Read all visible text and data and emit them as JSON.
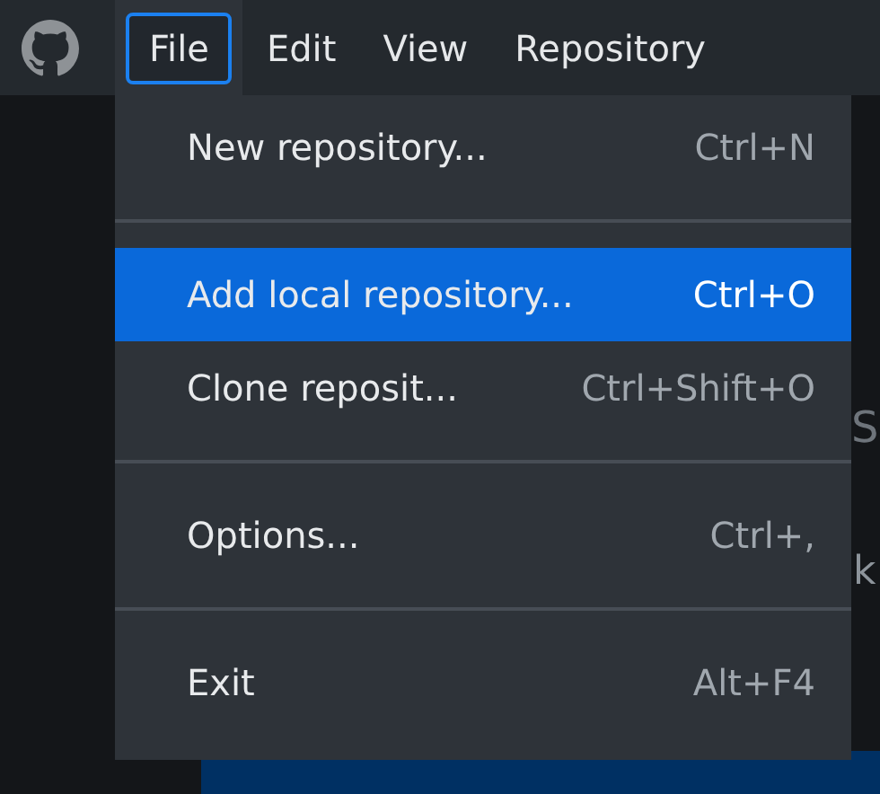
{
  "menu_bar": [
    {
      "label": "File",
      "selected": true
    },
    {
      "label": "Edit",
      "selected": false
    },
    {
      "label": "View",
      "selected": false
    },
    {
      "label": "Repository",
      "selected": false
    }
  ],
  "file_menu": [
    {
      "kind": "item",
      "label": "New repository...",
      "shortcut": "Ctrl+N",
      "selected": false
    },
    {
      "kind": "separator"
    },
    {
      "kind": "item",
      "label": "Add local repository...",
      "shortcut": "Ctrl+O",
      "selected": true
    },
    {
      "kind": "item",
      "label": "Clone reposit...",
      "shortcut": "Ctrl+Shift+O",
      "selected": false
    },
    {
      "kind": "separator"
    },
    {
      "kind": "item",
      "label": "Options...",
      "shortcut": "Ctrl+,",
      "selected": false
    },
    {
      "kind": "separator"
    },
    {
      "kind": "item",
      "label": "Exit",
      "shortcut": "Alt+F4",
      "selected": false
    }
  ],
  "background": {
    "heading": "S",
    "text": "k"
  }
}
